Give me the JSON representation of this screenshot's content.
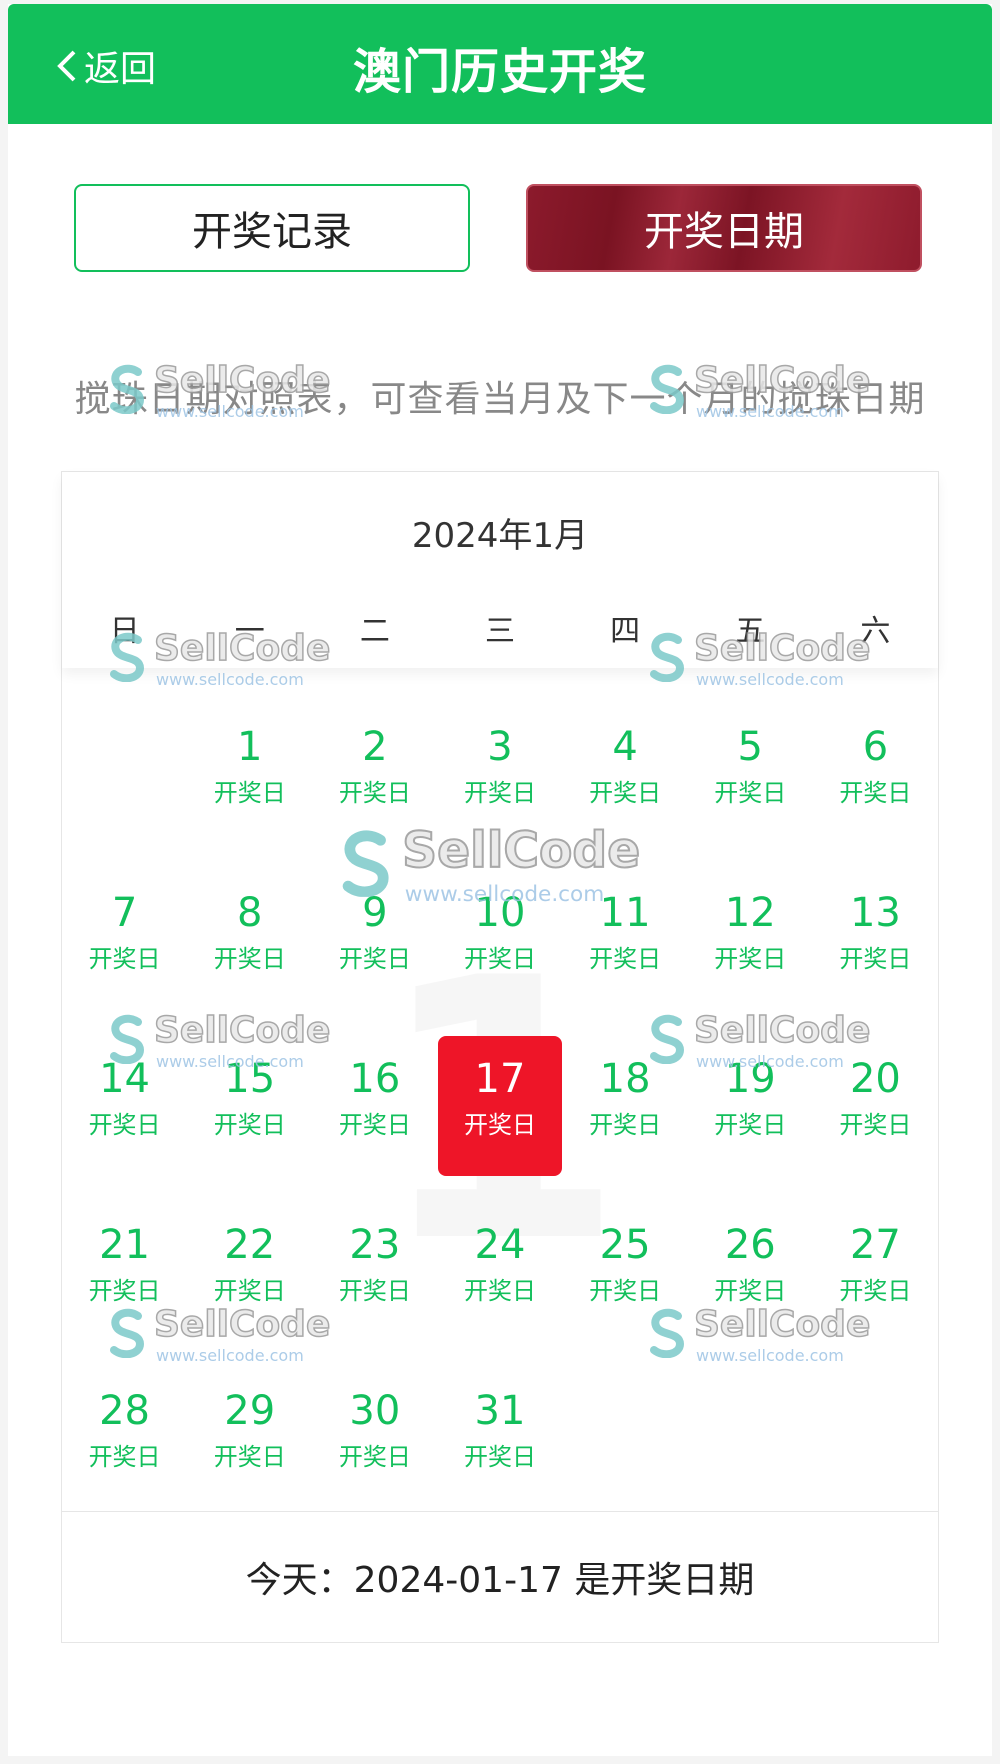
{
  "header": {
    "back_label": "返回",
    "title": "澳门历史开奖"
  },
  "tabs": [
    {
      "label": "开奖记录",
      "active": false
    },
    {
      "label": "开奖日期",
      "active": true
    }
  ],
  "description": "搅珠日期对照表，可查看当月及下一个月的搅珠日期",
  "calendar": {
    "month_title": "2024年1月",
    "weekdays": [
      "日",
      "一",
      "二",
      "三",
      "四",
      "五",
      "六"
    ],
    "first_weekday_offset": 1,
    "background_number": "1",
    "day_label": "开奖日",
    "today": 17,
    "days": [
      1,
      2,
      3,
      4,
      5,
      6,
      7,
      8,
      9,
      10,
      11,
      12,
      13,
      14,
      15,
      16,
      17,
      18,
      19,
      20,
      21,
      22,
      23,
      24,
      25,
      26,
      27,
      28,
      29,
      30,
      31
    ],
    "footer_text": "今天：2024-01-17 是开奖日期"
  },
  "watermark": {
    "brand": "SellCode",
    "url": "www.sellcode.com"
  },
  "colors": {
    "brand_green": "#12bf5b",
    "today_red": "#ee1528",
    "active_tab": "#8c1a2c"
  }
}
